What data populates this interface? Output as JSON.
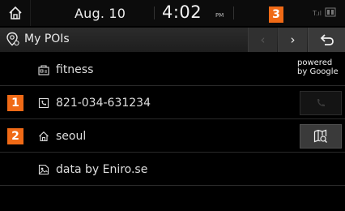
{
  "status": {
    "date": "Aug. 10",
    "time": "4:02",
    "ampm": "PM",
    "signal": "T.ıl"
  },
  "badges": [
    "1",
    "2",
    "3"
  ],
  "header": {
    "title": "My POIs"
  },
  "rows": [
    {
      "label": "fitness",
      "icon": "category-icon"
    },
    {
      "label": "821-034-631234",
      "icon": "phone-icon"
    },
    {
      "label": "seoul",
      "icon": "home-icon"
    },
    {
      "label": "data by Eniro.se",
      "icon": "data-source-icon"
    }
  ],
  "powered": {
    "line1": "powered",
    "line2": "by Google"
  },
  "colors": {
    "accent": "#f06a16",
    "background": "#000000",
    "header": "#262626"
  }
}
